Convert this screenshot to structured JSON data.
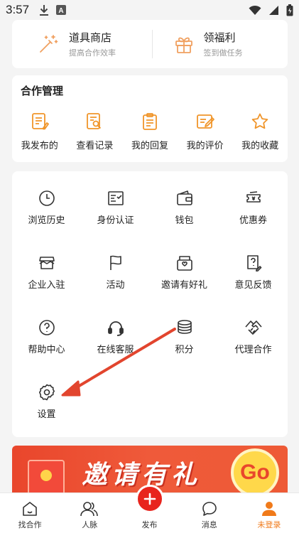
{
  "status": {
    "time": "3:57"
  },
  "top": [
    {
      "title": "道具商店",
      "subtitle": "提高合作效率",
      "icon": "magic-wand-icon"
    },
    {
      "title": "领福利",
      "subtitle": "签到做任务",
      "icon": "gift-icon"
    }
  ],
  "coop": {
    "title": "合作管理",
    "items": [
      {
        "label": "我发布的",
        "icon": "edit-document-icon"
      },
      {
        "label": "查看记录",
        "icon": "search-document-icon"
      },
      {
        "label": "我的回复",
        "icon": "clipboard-reply-icon"
      },
      {
        "label": "我的评价",
        "icon": "review-edit-icon"
      },
      {
        "label": "我的收藏",
        "icon": "star-icon"
      }
    ]
  },
  "services": [
    {
      "label": "浏览历史",
      "icon": "clock-icon"
    },
    {
      "label": "身份认证",
      "icon": "id-card-icon"
    },
    {
      "label": "钱包",
      "icon": "wallet-icon"
    },
    {
      "label": "优惠券",
      "icon": "coupon-icon"
    },
    {
      "label": "企业入驻",
      "icon": "storefront-icon"
    },
    {
      "label": "活动",
      "icon": "flag-icon"
    },
    {
      "label": "邀请有好礼",
      "icon": "invite-gift-icon"
    },
    {
      "label": "意见反馈",
      "icon": "feedback-icon"
    },
    {
      "label": "帮助中心",
      "icon": "help-icon"
    },
    {
      "label": "在线客服",
      "icon": "headset-icon"
    },
    {
      "label": "积分",
      "icon": "coins-icon"
    },
    {
      "label": "代理合作",
      "icon": "handshake-icon"
    },
    {
      "label": "设置",
      "icon": "gear-icon"
    }
  ],
  "banner": {
    "text": "邀请有礼",
    "go": "Go"
  },
  "nav": [
    {
      "label": "找合作",
      "icon": "home-icon"
    },
    {
      "label": "人脉",
      "icon": "contacts-icon"
    },
    {
      "label": "发布",
      "icon": "plus-icon"
    },
    {
      "label": "消息",
      "icon": "message-icon"
    },
    {
      "label": "未登录",
      "icon": "user-icon"
    }
  ],
  "colors": {
    "accent": "#f07a1a",
    "publish": "#e8241d",
    "banner": "#ee5a36",
    "arrow": "#e2452e"
  }
}
